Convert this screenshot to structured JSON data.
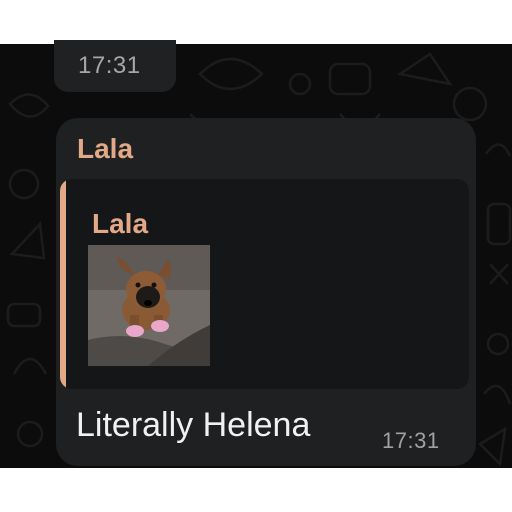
{
  "separator_time": "17:31",
  "message": {
    "sender": "Lala",
    "quoted_sender": "Lala",
    "quoted_media": "photo",
    "text": "Literally Helena",
    "time": "17:31"
  },
  "colors": {
    "background": "#0c0c0c",
    "bubble": "#1f2022",
    "quote_background": "#151617",
    "sender_accent": "#e1a987"
  }
}
